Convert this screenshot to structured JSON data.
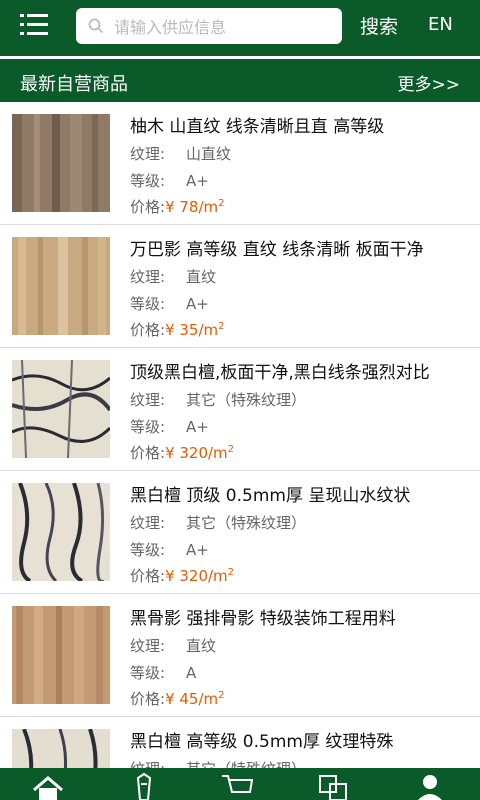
{
  "header": {
    "menu_icon": "list-menu-icon",
    "search": {
      "placeholder": "请输入供应信息",
      "value": "",
      "icon": "search-icon"
    },
    "search_label": "搜索",
    "lang_label": "EN"
  },
  "section": {
    "title": "最新自营商品",
    "more_label": "更多>>"
  },
  "labels": {
    "texture": "纹理:",
    "grade": "等级:",
    "price": "价格:"
  },
  "products": [
    {
      "name": "柚木 山直纹 线条清晰且直 高等级",
      "texture": "山直纹",
      "grade": "A+",
      "price_prefix": "¥ 78/m",
      "price_unit_sup": "2"
    },
    {
      "name": "万巴影 高等级 直纹 线条清晰 板面干净",
      "texture": "直纹",
      "grade": "A+",
      "price_prefix": "¥ 35/m",
      "price_unit_sup": "2"
    },
    {
      "name": "顶级黑白檀,板面干净,黑白线条强烈对比",
      "texture": "其它（特殊纹理）",
      "grade": "A+",
      "price_prefix": "¥ 320/m",
      "price_unit_sup": "2"
    },
    {
      "name": "黑白檀 顶级 0.5mm厚 呈现山水纹状",
      "texture": "其它（特殊纹理）",
      "grade": "A+",
      "price_prefix": "¥ 320/m",
      "price_unit_sup": "2"
    },
    {
      "name": "黑骨影 强排骨影 特级装饰工程用料",
      "texture": "直纹",
      "grade": "A",
      "price_prefix": "¥ 45/m",
      "price_unit_sup": "2"
    },
    {
      "name": "黑白檀 高等级 0.5mm厚 纹理特殊",
      "texture": "其它（特殊纹理）",
      "grade": "",
      "price_prefix": "",
      "price_unit_sup": ""
    }
  ],
  "bottom_nav": [
    "home-icon",
    "category-icon",
    "cart-icon",
    "orders-icon",
    "user-icon"
  ],
  "colors": {
    "brand": "#0b5a2a",
    "price": "#e65b00"
  }
}
